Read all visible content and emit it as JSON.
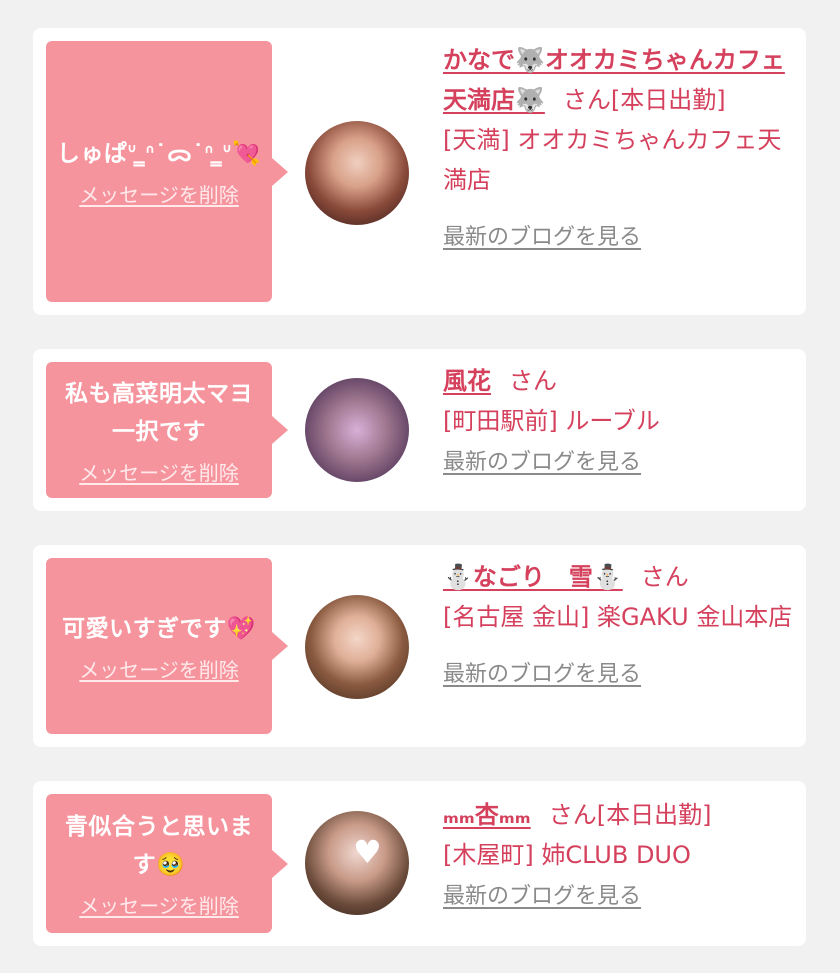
{
  "delete_label": "メッセージを削除",
  "blog_label": "最新のブログを見る",
  "suffix": "さん",
  "messages": [
    {
      "message": "しゅぱᐡ ̳ᐢ˙ᯅ˙ᐢ ̳ᐡ",
      "cast_name": "かなで🐺オオカミちゃんカフェ天満店🐺",
      "status": "[本日出勤]",
      "area_shop": "[天満] オオカミちゃんカフェ天満店"
    },
    {
      "message": "私も高菜明太マヨ一択です",
      "cast_name": "風花",
      "status": "",
      "area_shop": "[町田駅前] ルーブル"
    },
    {
      "message": "可愛いすぎです",
      "cast_name": "⛄なごり　雪⛄",
      "status": "",
      "area_shop": "[名古屋 金山] 楽GAKU 金山本店"
    },
    {
      "message": "青似合うと思います",
      "cast_name": "ₘₘ杏ₘₘ",
      "status": "[本日出勤]",
      "area_shop": "[木屋町] 姉CLUB DUO"
    }
  ],
  "colors": {
    "background": "#f1f1f1",
    "bubble": "#f6949d",
    "accent_text": "#d5415d",
    "link_gray": "#8a8a8a"
  },
  "icons": [
    "wolf-icon",
    "heart-arrow-icon",
    "sparkling-heart-icon",
    "snowman-icon",
    "pleading-face-icon",
    "avatar-photo"
  ]
}
